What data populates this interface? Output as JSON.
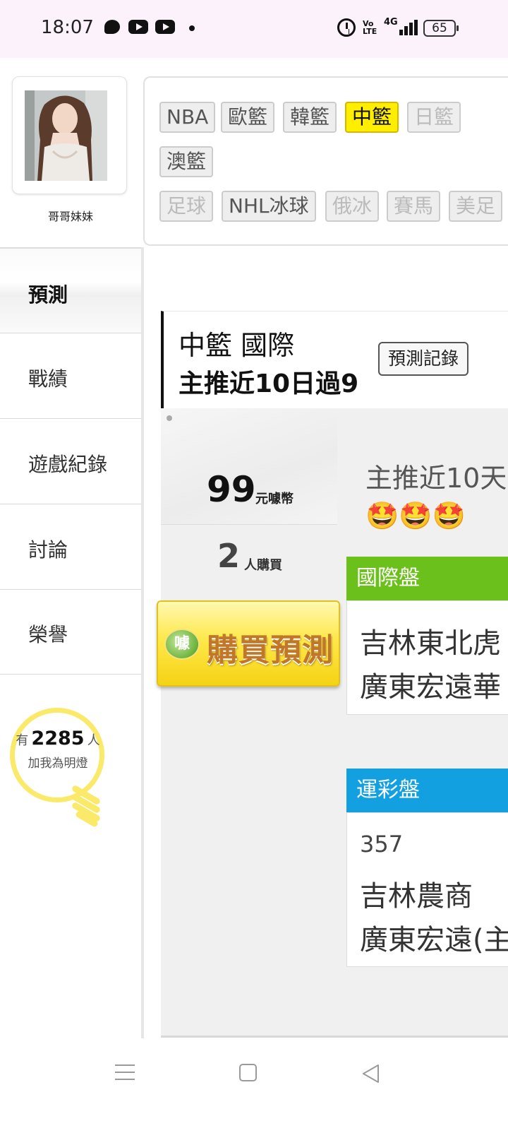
{
  "status_bar": {
    "time": "18:07",
    "volte": "Vo LTE",
    "network": "4G",
    "battery": "65",
    "icons": [
      "chat-bubble-icon",
      "youtube-icon",
      "youtube-icon",
      "dot-icon",
      "alarm-icon",
      "signal-icon",
      "battery-icon"
    ]
  },
  "profile": {
    "name": "哥哥妹妹"
  },
  "sidebar": {
    "items": [
      {
        "label": "預測",
        "active": true
      },
      {
        "label": "戰績"
      },
      {
        "label": "遊戲紀錄"
      },
      {
        "label": "討論"
      },
      {
        "label": "榮譽"
      }
    ]
  },
  "fans": {
    "prefix": "有",
    "count": "2285",
    "suffix": "人",
    "line2": "加我為明燈"
  },
  "categories": {
    "row1": [
      "NBA",
      "歐籃",
      "韓籃",
      "中籃",
      "日籃"
    ],
    "row2": [
      "澳籃"
    ],
    "row3": [
      "足球",
      "NHL冰球",
      "俄冰",
      "賽馬",
      "美足"
    ],
    "active": "中籃"
  },
  "prediction": {
    "title": "中籃 國際",
    "subtitle": "主推近10日過9",
    "record_button": "預測記錄",
    "price": "99",
    "price_unit": "元噱幣",
    "buyers": "2",
    "buyers_unit": "人購買",
    "buy_button": "購買預測",
    "coin_glyph": "噱",
    "pick_title": "主推近10天",
    "emojis": "🤩🤩🤩"
  },
  "cards": {
    "international": {
      "header": "國際盤",
      "lines": [
        "吉林東北虎",
        "廣東宏遠華"
      ]
    },
    "sports_lottery": {
      "header": "運彩盤",
      "code": "357",
      "lines": [
        "吉林農商",
        "廣東宏遠(主"
      ]
    }
  },
  "colors": {
    "active_tag": "#ffee00",
    "international_header": "#6cc01c",
    "sports_lottery_header": "#12a0e0",
    "buy_button": "#ffe84a"
  }
}
